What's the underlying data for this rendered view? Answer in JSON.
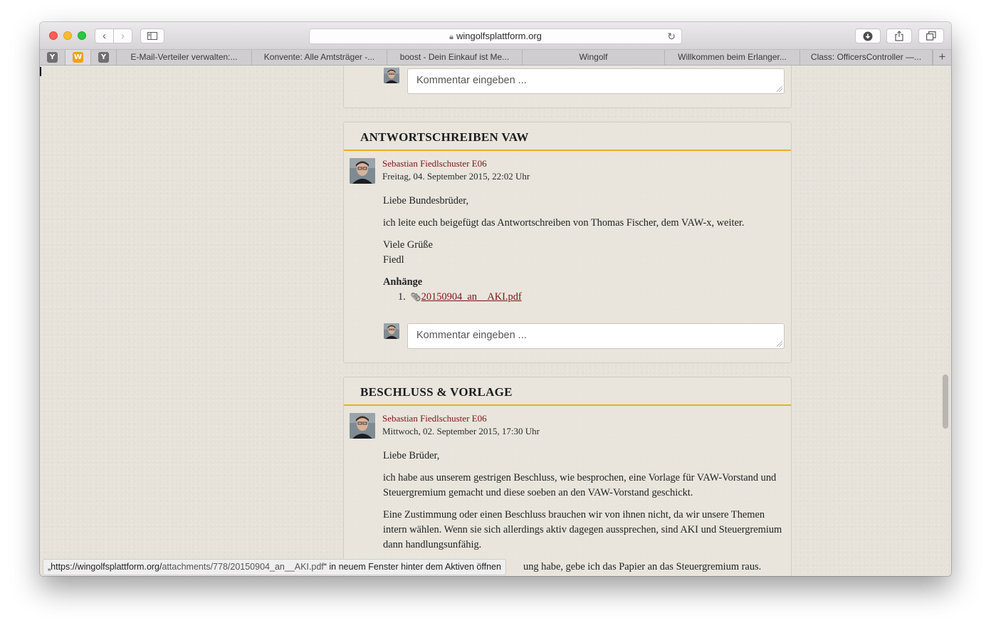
{
  "browser": {
    "url": "wingolfsplattform.org",
    "pinned_tabs": [
      {
        "icon": "Y",
        "color": "#6f6f6f"
      },
      {
        "icon": "W",
        "color": "#f0a20f"
      },
      {
        "icon": "Y",
        "color": "#6f6f6f"
      }
    ],
    "tabs": [
      {
        "label": "E-Mail-Verteiler verwalten:..."
      },
      {
        "label": "Konvente: Alle Amtsträger -..."
      },
      {
        "label": "boost - Dein Einkauf ist Me..."
      },
      {
        "label": "Wingolf"
      },
      {
        "label": "Willkommen beim Erlanger..."
      },
      {
        "label": "Class: OfficersController —..."
      }
    ],
    "new_tab_label": "+"
  },
  "comment_placeholder": "Kommentar eingeben ...",
  "top_comment": {
    "placeholder": "Kommentar eingeben ..."
  },
  "posts": [
    {
      "title": "Antwortschreiben VAW",
      "author": "Sebastian Fiedlschuster E06",
      "date": "Freitag, 04. September 2015, 22:02 Uhr",
      "paragraphs": [
        "Liebe Bundesbrüder,",
        "ich leite euch beigefügt das Antwortschreiben von Thomas Fischer, dem VAW-x, weiter.",
        "Viele Grüße",
        "Fiedl"
      ],
      "attachments_heading": "Anhänge",
      "attachments": [
        {
          "number": "1.",
          "name": "20150904_an__AKI.pdf"
        }
      ],
      "comment_placeholder": "Kommentar eingeben ..."
    },
    {
      "title": "Beschluss & Vorlage",
      "author": "Sebastian Fiedlschuster E06",
      "date": "Mittwoch, 02. September 2015, 17:30 Uhr",
      "paragraphs": [
        "Liebe Brüder,",
        "ich habe aus unserem gestrigen Beschluss, wie besprochen, eine Vorlage für VAW-Vorstand und Steuergremium gemacht und diese soeben an den VAW-Vorstand geschickt.",
        "Eine Zustimmung oder einen Beschluss brauchen wir von ihnen nicht, da wir unsere Themen intern wählen. Wenn sie sich allerdings aktiv dagegen aussprechen, sind AKI und Steuergremium dann handlungsunfähig.",
        "ung habe, gebe ich das Papier an das Steuergremium raus."
      ]
    }
  ],
  "status_bar": {
    "prefix": "„https://wingolfsplattform.org/",
    "path": "attachments/778/20150904_an__AKI.pdf",
    "suffix": "“ in neuem Fenster hinter dem Aktiven öffnen"
  },
  "colors": {
    "accent_gold": "#e2b423",
    "link_red": "#7a1515",
    "page_bg": "#e6e2da"
  }
}
